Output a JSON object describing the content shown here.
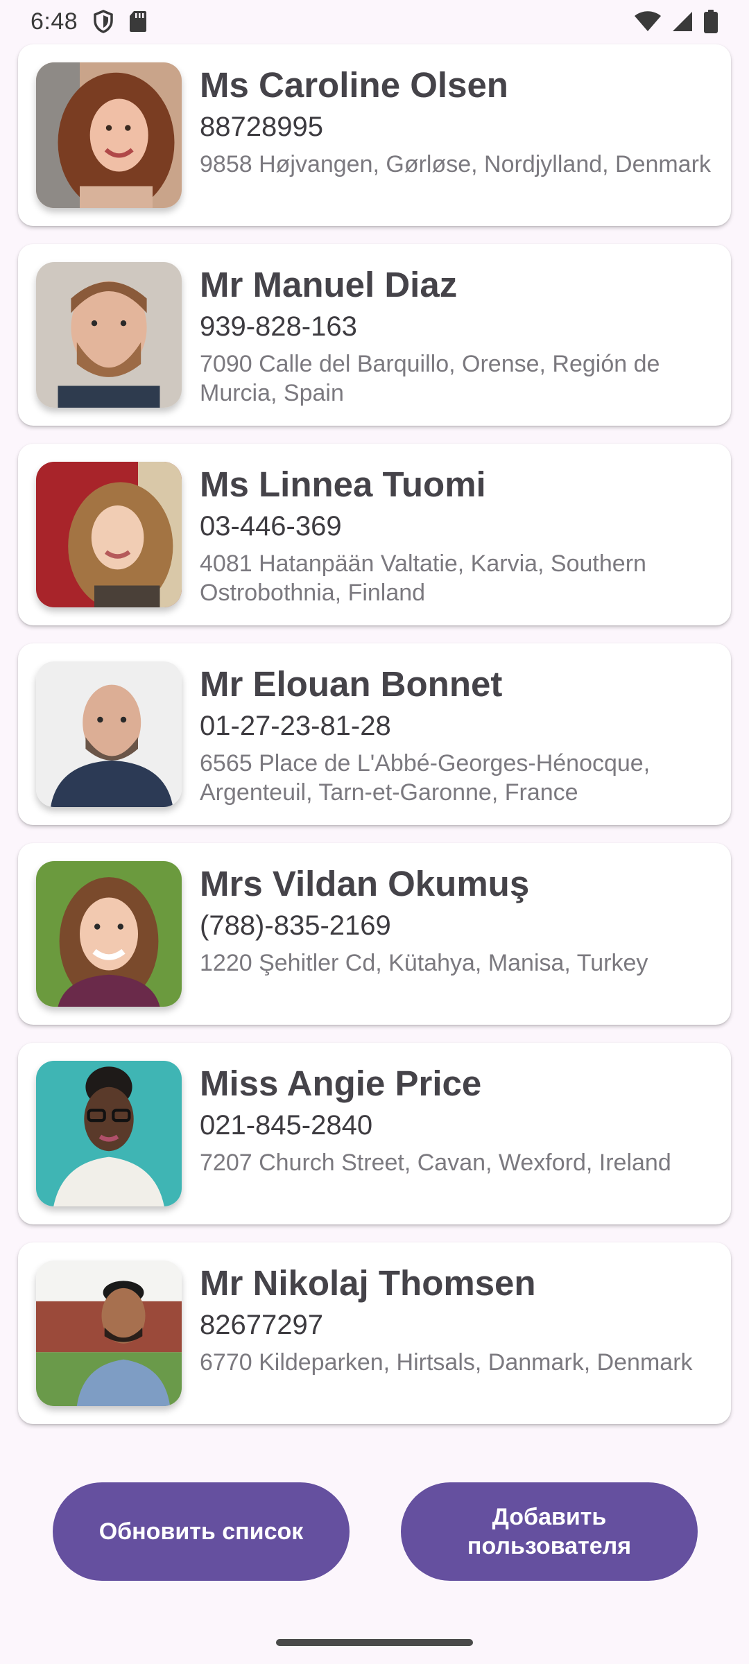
{
  "status_bar": {
    "time": "6:48",
    "left_icons": [
      "shield-icon",
      "sd-card-icon"
    ],
    "right_icons": [
      "wifi-icon",
      "cellular-signal-icon",
      "battery-icon"
    ]
  },
  "contacts": [
    {
      "name": "Ms Caroline Olsen",
      "phone": "88728995",
      "address": "9858 Højvangen, Gørløse, Nordjylland, Denmark"
    },
    {
      "name": "Mr Manuel Diaz",
      "phone": "939-828-163",
      "address": "7090 Calle del Barquillo, Orense, Región de Murcia, Spain"
    },
    {
      "name": "Ms Linnea Tuomi",
      "phone": "03-446-369",
      "address": "4081 Hatanpään Valtatie, Karvia, Southern Ostrobothnia, Finland"
    },
    {
      "name": "Mr Elouan Bonnet",
      "phone": "01-27-23-81-28",
      "address": "6565 Place de L'Abbé-Georges-Hénocque, Argenteuil, Tarn-et-Garonne, France"
    },
    {
      "name": "Mrs Vildan Okumuş",
      "phone": "(788)-835-2169",
      "address": "1220 Şehitler Cd, Kütahya, Manisa, Turkey"
    },
    {
      "name": "Miss Angie Price",
      "phone": "021-845-2840",
      "address": "7207 Church Street, Cavan, Wexford, Ireland"
    },
    {
      "name": "Mr Nikolaj Thomsen",
      "phone": "82677297",
      "address": "6770 Kildeparken, Hirtsals, Danmark, Denmark"
    }
  ],
  "buttons": {
    "refresh_label": "Обновить список",
    "add_label": "Добавить пользователя"
  },
  "colors": {
    "background": "#fcf6fc",
    "card": "#ffffff",
    "button": "#65509f",
    "name_text": "#454349",
    "address_text": "#7b797f"
  }
}
